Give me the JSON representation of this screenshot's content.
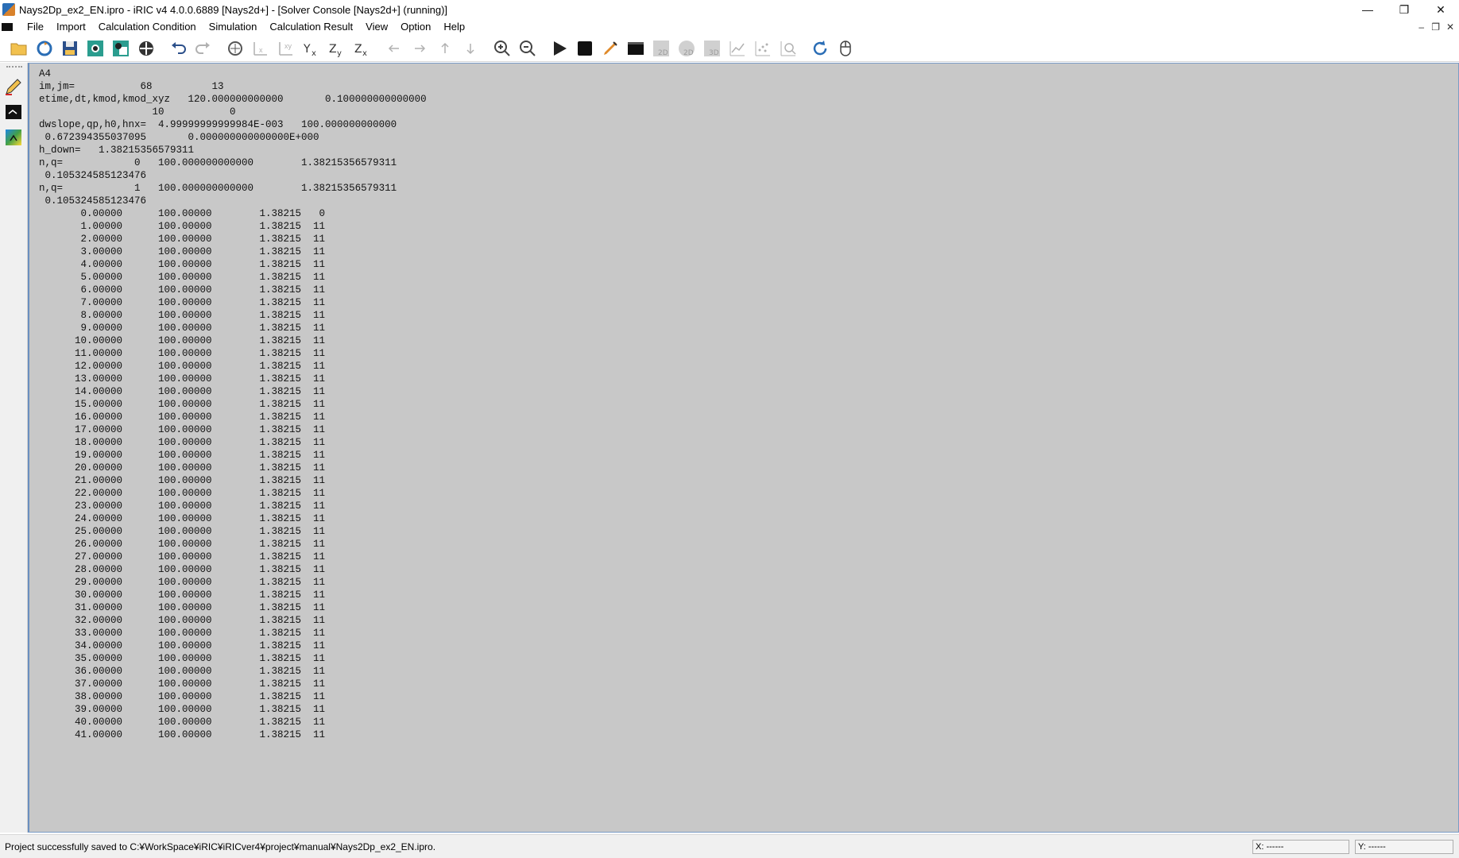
{
  "window": {
    "title": "Nays2Dp_ex2_EN.ipro - iRIC v4 4.0.0.6889 [Nays2d+] - [Solver Console [Nays2d+] (running)]",
    "minimize_glyph": "—",
    "maximize_glyph": "❐",
    "close_glyph": "✕"
  },
  "menubar": {
    "items": [
      "File",
      "Import",
      "Calculation Condition",
      "Simulation",
      "Calculation Result",
      "View",
      "Option",
      "Help"
    ],
    "mdi_minimize": "–",
    "mdi_restore": "❐",
    "mdi_close": "✕"
  },
  "toolbar": {
    "icons": [
      "open-folder-icon",
      "reload-icon",
      "save-icon",
      "camera-icon",
      "camera-window-icon",
      "fit-icon",
      "undo-icon",
      "redo-icon",
      "zoom-fit-icon",
      "axis-x-icon",
      "axis-xy-icon",
      "yx-icon",
      "zy-icon",
      "zx-icon",
      "arrow-left-icon",
      "arrow-right-icon",
      "arrow-up-icon",
      "arrow-down-icon",
      "zoom-in-icon",
      "zoom-out-icon",
      "run-icon",
      "stop-icon",
      "pen-icon",
      "console-icon",
      "2d-post-icon",
      "2d-bird-icon",
      "3d-post-icon",
      "graph-icon",
      "scatter-icon",
      "magnify-chart-icon",
      "refresh-icon",
      "mouse-icon"
    ],
    "accent": "#2a6db5"
  },
  "console": {
    "background": "#c8c8c8",
    "lines": [
      "A4",
      "im,jm=           68          13",
      "etime,dt,kmod,kmod_xyz   120.000000000000       0.100000000000000",
      "                   10           0",
      "dwslope,qp,h0,hnx=  4.99999999999984E-003   100.000000000000",
      " 0.672394355037095       0.000000000000000E+000",
      "h_down=   1.38215356579311",
      "n,q=            0   100.000000000000        1.38215356579311",
      " 0.105324585123476",
      "n,q=            1   100.000000000000        1.38215356579311",
      " 0.105324585123476",
      "       0.00000      100.00000        1.38215   0",
      "       1.00000      100.00000        1.38215  11",
      "       2.00000      100.00000        1.38215  11",
      "       3.00000      100.00000        1.38215  11",
      "       4.00000      100.00000        1.38215  11",
      "       5.00000      100.00000        1.38215  11",
      "       6.00000      100.00000        1.38215  11",
      "       7.00000      100.00000        1.38215  11",
      "       8.00000      100.00000        1.38215  11",
      "       9.00000      100.00000        1.38215  11",
      "      10.00000      100.00000        1.38215  11",
      "      11.00000      100.00000        1.38215  11",
      "      12.00000      100.00000        1.38215  11",
      "      13.00000      100.00000        1.38215  11",
      "      14.00000      100.00000        1.38215  11",
      "      15.00000      100.00000        1.38215  11",
      "      16.00000      100.00000        1.38215  11",
      "      17.00000      100.00000        1.38215  11",
      "      18.00000      100.00000        1.38215  11",
      "      19.00000      100.00000        1.38215  11",
      "      20.00000      100.00000        1.38215  11",
      "      21.00000      100.00000        1.38215  11",
      "      22.00000      100.00000        1.38215  11",
      "      23.00000      100.00000        1.38215  11",
      "      24.00000      100.00000        1.38215  11",
      "      25.00000      100.00000        1.38215  11",
      "      26.00000      100.00000        1.38215  11",
      "      27.00000      100.00000        1.38215  11",
      "      28.00000      100.00000        1.38215  11",
      "      29.00000      100.00000        1.38215  11",
      "      30.00000      100.00000        1.38215  11",
      "      31.00000      100.00000        1.38215  11",
      "      32.00000      100.00000        1.38215  11",
      "      33.00000      100.00000        1.38215  11",
      "      34.00000      100.00000        1.38215  11",
      "      35.00000      100.00000        1.38215  11",
      "      36.00000      100.00000        1.38215  11",
      "      37.00000      100.00000        1.38215  11",
      "      38.00000      100.00000        1.38215  11",
      "      39.00000      100.00000        1.38215  11",
      "      40.00000      100.00000        1.38215  11",
      "      41.00000      100.00000        1.38215  11"
    ]
  },
  "statusbar": {
    "message": "Project successfully saved to C:¥WorkSpace¥iRIC¥iRICver4¥project¥manual¥Nays2Dp_ex2_EN.ipro.",
    "x_readout": "X: ------",
    "y_readout": "Y: ------"
  }
}
